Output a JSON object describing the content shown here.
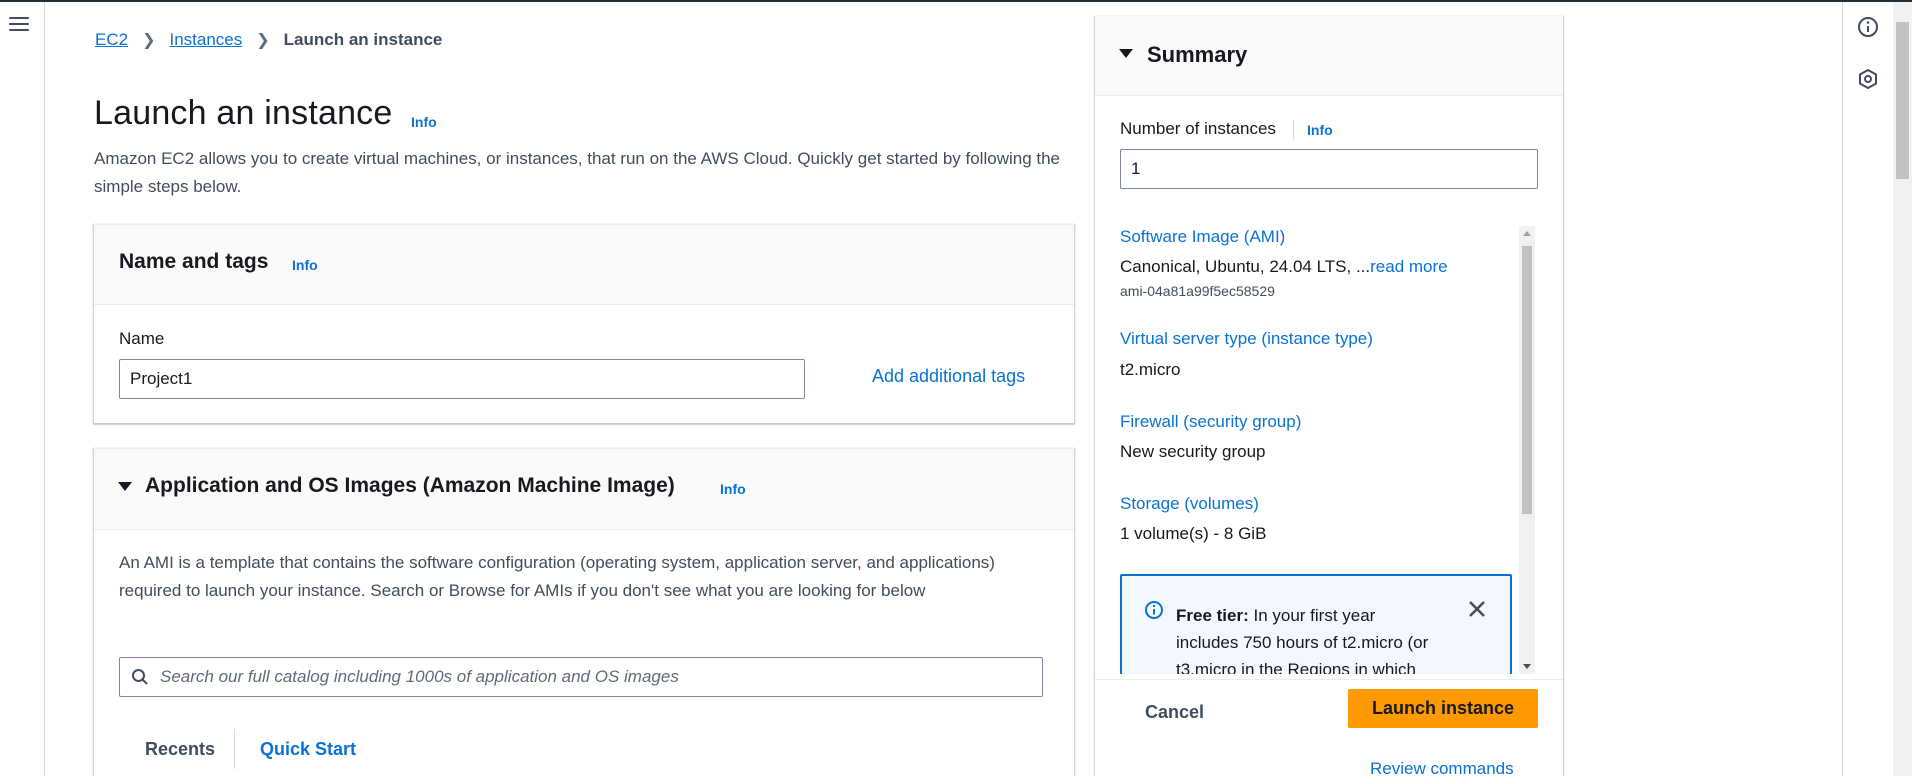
{
  "breadcrumb": {
    "ec2": "EC2",
    "instances": "Instances",
    "current": "Launch an instance"
  },
  "page": {
    "title": "Launch an instance",
    "info": "Info",
    "description": "Amazon EC2 allows you to create virtual machines, or instances, that run on the AWS Cloud. Quickly get started by following the simple steps below."
  },
  "name_tags": {
    "title": "Name and tags",
    "info": "Info",
    "name_label": "Name",
    "name_value": "Project1",
    "add_tags": "Add additional tags"
  },
  "ami_section": {
    "title": "Application and OS Images (Amazon Machine Image)",
    "info": "Info",
    "description": "An AMI is a template that contains the software configuration (operating system, application server, and applications) required to launch your instance. Search or Browse for AMIs if you don't see what you are looking for below",
    "search_placeholder": "Search our full catalog including 1000s of application and OS images",
    "tabs": [
      "Recents",
      "Quick Start"
    ]
  },
  "summary": {
    "title": "Summary",
    "num_instances_label": "Number of instances",
    "info": "Info",
    "num_instances_value": "1",
    "ami_label": "Software Image (AMI)",
    "ami_value": "Canonical, Ubuntu, 24.04 LTS, ...",
    "read_more": "read more",
    "ami_id": "ami-04a81a99f5ec58529",
    "instance_type_label": "Virtual server type (instance type)",
    "instance_type_value": "t2.micro",
    "firewall_label": "Firewall (security group)",
    "firewall_value": "New security group",
    "storage_label": "Storage (volumes)",
    "storage_value": "1 volume(s) - 8 GiB",
    "free_tier_bold": "Free tier:",
    "free_tier_text_1": " In your first year",
    "free_tier_text_2": "includes 750 hours of t2.micro (or",
    "free_tier_text_3": "t3.micro in the Regions in which"
  },
  "footer": {
    "cancel": "Cancel",
    "launch": "Launch instance",
    "review": "Review commands"
  },
  "colors": {
    "link": "#0972d3",
    "launch_button": "#ff9900",
    "text": "#16191f",
    "secondary_text": "#414d5c"
  }
}
